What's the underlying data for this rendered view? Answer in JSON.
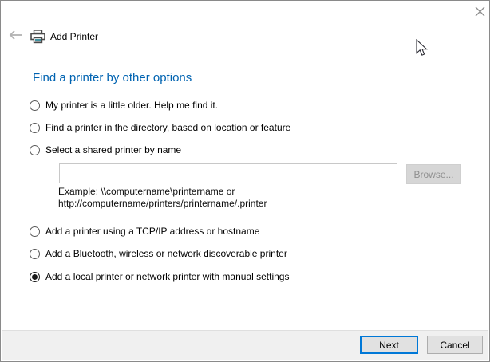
{
  "window": {
    "close_icon": "close"
  },
  "header": {
    "back_icon": "back-arrow",
    "app_icon": "printer",
    "title": "Add Printer"
  },
  "heading": "Find a printer by other options",
  "options": [
    {
      "label": "My printer is a little older. Help me find it.",
      "selected": false
    },
    {
      "label": "Find a printer in the directory, based on location or feature",
      "selected": false
    },
    {
      "label": "Select a shared printer by name",
      "selected": false
    },
    {
      "label": "Add a printer using a TCP/IP address or hostname",
      "selected": false
    },
    {
      "label": "Add a Bluetooth, wireless or network discoverable printer",
      "selected": false
    },
    {
      "label": "Add a local printer or network printer with manual settings",
      "selected": true
    }
  ],
  "shared_printer": {
    "input_value": "",
    "browse_label": "Browse...",
    "example_line1": "Example: \\\\computername\\printername or",
    "example_line2": "http://computername/printers/printername/.printer"
  },
  "footer": {
    "next_label": "Next",
    "cancel_label": "Cancel"
  },
  "colors": {
    "heading_blue": "#0063b1",
    "accent_blue": "#0078d7",
    "footer_bg": "#f0f0f0",
    "disabled_text": "#8f8f8f"
  }
}
